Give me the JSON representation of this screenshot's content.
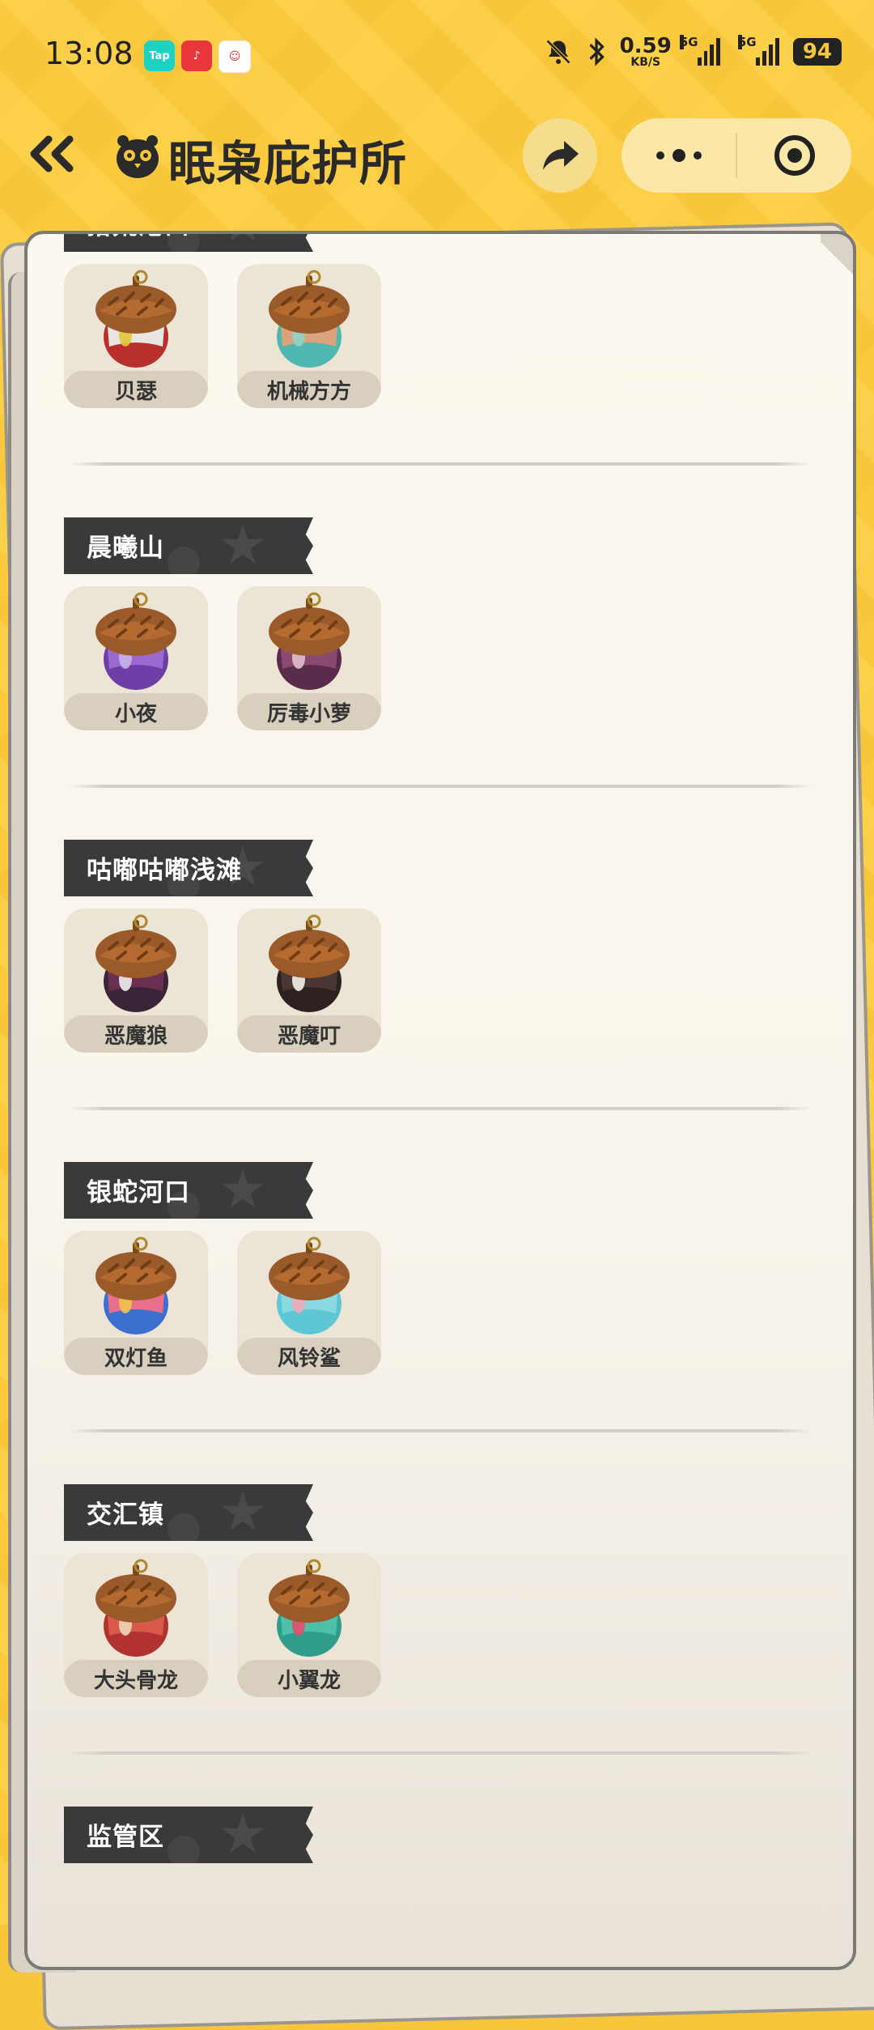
{
  "status_bar": {
    "time": "13:08",
    "apps": [
      {
        "name": "Tap",
        "color": "#1fd1c0"
      },
      {
        "name": "music",
        "color": "#e8363b"
      },
      {
        "name": "game",
        "color": "#ffffff"
      }
    ],
    "net_speed_value": "0.59",
    "net_speed_unit": "KB/S",
    "signal1_label": "5G",
    "signal2_label": "5G",
    "battery": "94"
  },
  "nav": {
    "back_icon": "double-chevron-left-icon",
    "title": "眠枭庇护所",
    "share_icon": "share-arrow-icon",
    "more_icon": "more-dots-icon",
    "target_icon": "record-target-icon"
  },
  "colors": {
    "background": "#f8c63b",
    "card": "#fbf8ef",
    "header": "#3a3a3c",
    "item_bg": "#ece4d4"
  },
  "sections": [
    {
      "title": "拾荒港口",
      "items": [
        {
          "label": "贝瑟",
          "colors": [
            "#b8302c",
            "#e8e6e2",
            "#e0c93a"
          ]
        },
        {
          "label": "机械方方",
          "colors": [
            "#4fb6b0",
            "#d9a47a",
            "#8fd3c8"
          ]
        }
      ]
    },
    {
      "title": "晨曦山",
      "items": [
        {
          "label": "小夜",
          "colors": [
            "#6d3fa6",
            "#9a6ad0",
            "#c7b2e8"
          ]
        },
        {
          "label": "厉毒小萝",
          "colors": [
            "#5a2b4a",
            "#8a4a70",
            "#e0c0cc"
          ]
        }
      ]
    },
    {
      "title": "咕嘟咕嘟浅滩",
      "items": [
        {
          "label": "恶魔狼",
          "colors": [
            "#3a2438",
            "#6a3050",
            "#eeeeee"
          ]
        },
        {
          "label": "恶魔叮",
          "colors": [
            "#2e2220",
            "#4a3632",
            "#f2f0ea"
          ]
        }
      ]
    },
    {
      "title": "银蛇河口",
      "items": [
        {
          "label": "双灯鱼",
          "colors": [
            "#3c6fcf",
            "#e9708a",
            "#f3c34a"
          ]
        },
        {
          "label": "风铃鲨",
          "colors": [
            "#5fc6d6",
            "#8ad8e0",
            "#f0a8b8"
          ]
        }
      ]
    },
    {
      "title": "交汇镇",
      "items": [
        {
          "label": "大头骨龙",
          "colors": [
            "#b23232",
            "#d85a4a",
            "#f0d6b8"
          ]
        },
        {
          "label": "小翼龙",
          "colors": [
            "#2f9c8c",
            "#4cc0a8",
            "#e94c6a"
          ]
        }
      ]
    },
    {
      "title": "监管区",
      "items": []
    }
  ]
}
